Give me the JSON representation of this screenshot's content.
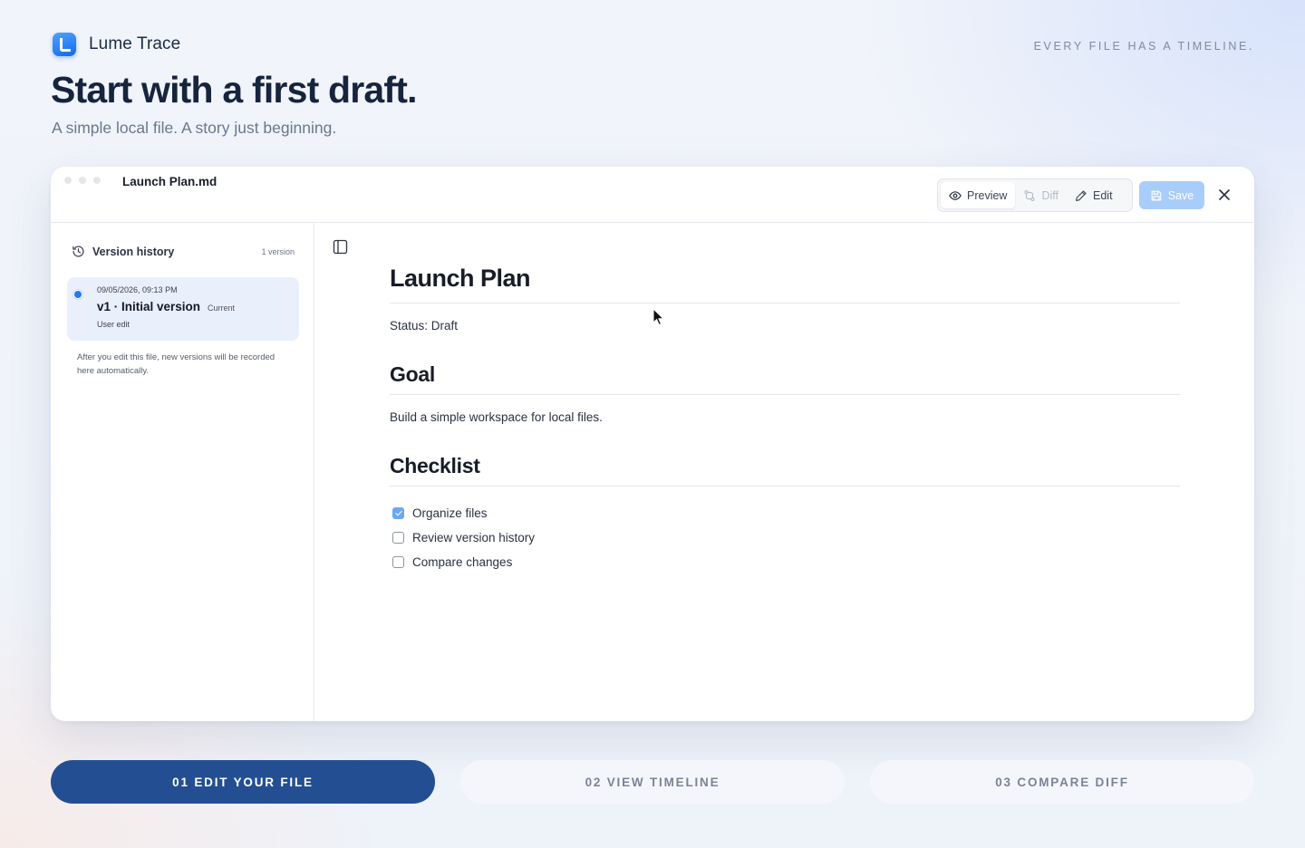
{
  "brand": {
    "name": "Lume Trace",
    "tagline": "EVERY FILE HAS A TIMELINE."
  },
  "hero": {
    "title": "Start with a first draft.",
    "subtitle": "A simple local file. A story just beginning."
  },
  "window": {
    "filename": "Launch Plan.md",
    "toolbar": {
      "preview": "Preview",
      "diff": "Diff",
      "edit": "Edit",
      "save": "Save"
    }
  },
  "sidebar": {
    "title": "Version history",
    "count": "1 version",
    "versions": [
      {
        "date": "09/05/2026, 09:13 PM",
        "title": "v1 · Initial version",
        "badge": "Current",
        "source": "User edit"
      }
    ],
    "note": "After you edit this file, new versions will be recorded here automatically."
  },
  "document": {
    "title": "Launch Plan",
    "status": "Status: Draft",
    "goal_heading": "Goal",
    "goal_text": "Build a simple workspace for local files.",
    "checklist_heading": "Checklist",
    "checklist": [
      {
        "label": "Organize files",
        "checked": true
      },
      {
        "label": "Review version history",
        "checked": false
      },
      {
        "label": "Compare changes",
        "checked": false
      }
    ]
  },
  "steps": [
    {
      "label": "01 EDIT YOUR FILE",
      "active": true
    },
    {
      "label": "02 VIEW TIMELINE",
      "active": false
    },
    {
      "label": "03 COMPARE DIFF",
      "active": false
    }
  ],
  "colors": {
    "accent": "#1b7cf3",
    "step_active": "#234f92",
    "save_disabled": "#a9cdfa"
  },
  "icons": [
    "app-logo-icon",
    "eye-icon",
    "diff-icon",
    "pencil-icon",
    "save-icon",
    "close-icon",
    "history-icon",
    "sidebar-toggle-icon",
    "cursor-icon"
  ]
}
